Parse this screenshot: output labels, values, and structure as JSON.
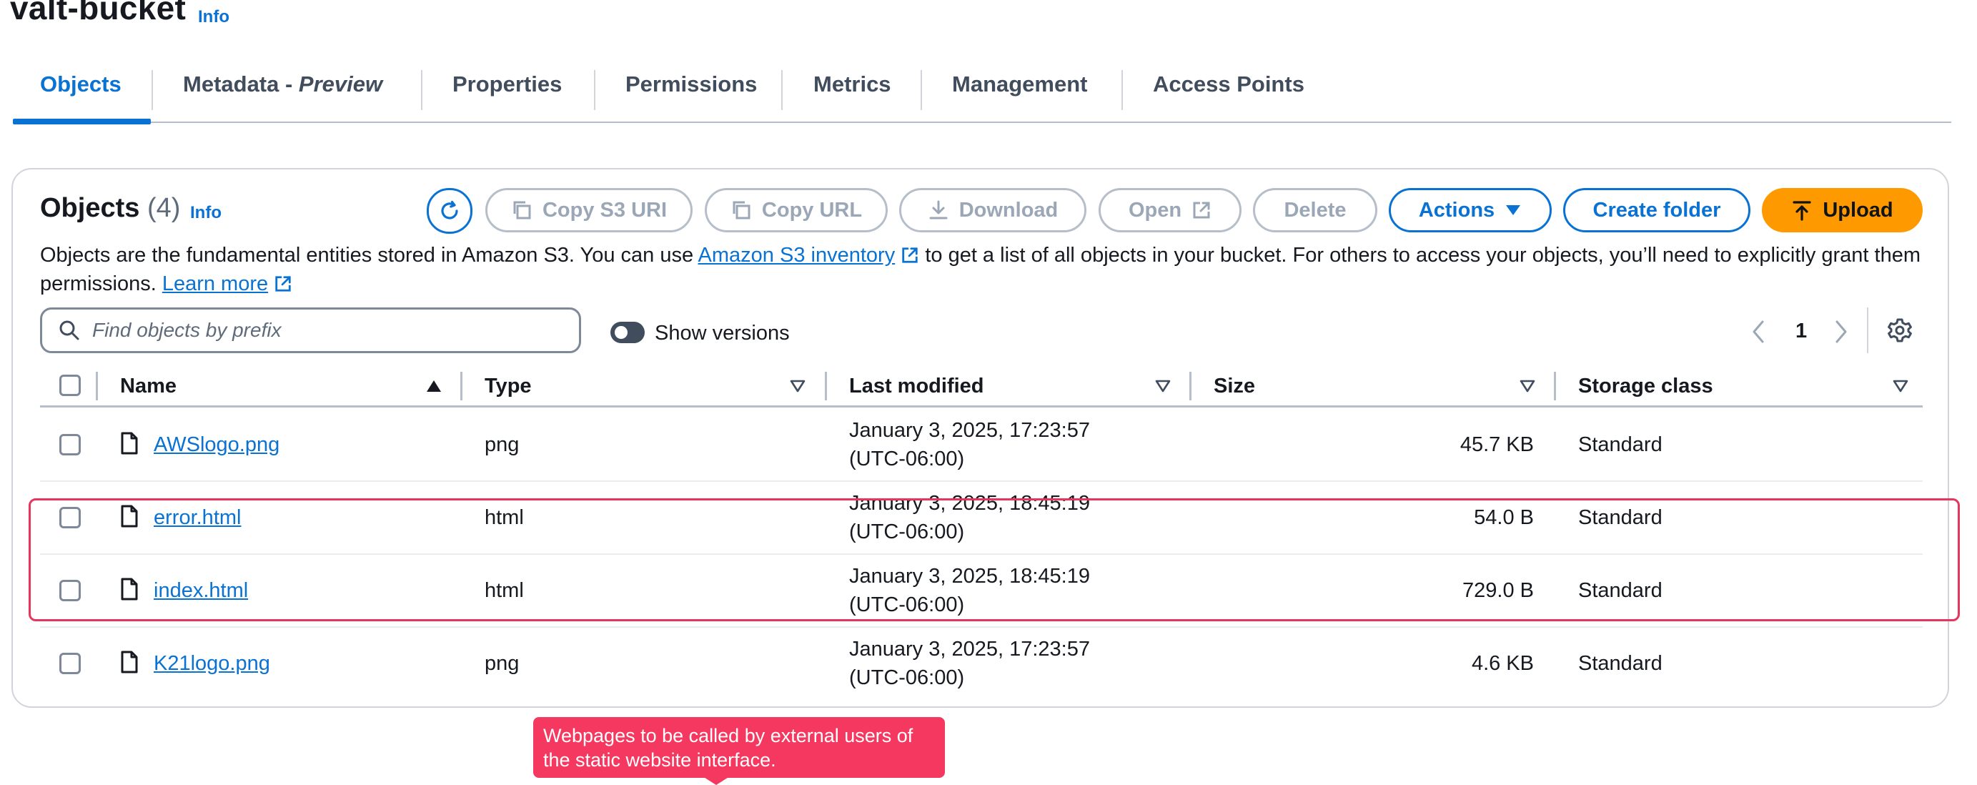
{
  "bucket": {
    "name": "valt-bucket",
    "info": "Info"
  },
  "tabs": [
    {
      "label": "Objects"
    },
    {
      "label": "Metadata - ",
      "emph": "Preview"
    },
    {
      "label": "Properties"
    },
    {
      "label": "Permissions"
    },
    {
      "label": "Metrics"
    },
    {
      "label": "Management"
    },
    {
      "label": "Access Points"
    }
  ],
  "objects_panel": {
    "title": "Objects",
    "count": "(4)",
    "info": "Info",
    "buttons": {
      "copy_s3_uri": "Copy S3 URI",
      "copy_url": "Copy URL",
      "download": "Download",
      "open": "Open",
      "delete": "Delete",
      "actions": "Actions",
      "create_folder": "Create folder",
      "upload": "Upload"
    },
    "description": {
      "part1": "Objects are the fundamental entities stored in Amazon S3. You can use ",
      "inventory_link": "Amazon S3 inventory",
      "part2": " to get a list of all objects in your bucket. For others to access your objects, you’ll need to explicitly grant them permissions. ",
      "learn_more": "Learn more"
    },
    "search": {
      "placeholder": "Find objects by prefix",
      "value": ""
    },
    "show_versions_label": "Show versions",
    "pagination": {
      "current_page": "1"
    }
  },
  "table": {
    "columns": [
      "Name",
      "Type",
      "Last modified",
      "Size",
      "Storage class"
    ],
    "rows": [
      {
        "name": "AWSlogo.png",
        "type": "png",
        "last_modified": "January 3, 2025, 17:23:57 (UTC-06:00)",
        "size": "45.7 KB",
        "storage_class": "Standard"
      },
      {
        "name": "error.html",
        "type": "html",
        "last_modified": "January 3, 2025, 18:45:19 (UTC-06:00)",
        "size": "54.0 B",
        "storage_class": "Standard"
      },
      {
        "name": "index.html",
        "type": "html",
        "last_modified": "January 3, 2025, 18:45:19 (UTC-06:00)",
        "size": "729.0 B",
        "storage_class": "Standard"
      },
      {
        "name": "K21logo.png",
        "type": "png",
        "last_modified": "January 3, 2025, 17:23:57 (UTC-06:00)",
        "size": "4.6 KB",
        "storage_class": "Standard"
      }
    ]
  },
  "annotation": {
    "text": "Webpages to be called by external users of the static website interface."
  },
  "colors": {
    "accent": "#0972d3",
    "upload": "#ff9900",
    "annotation": "#f5385f",
    "text": "#16191f"
  }
}
